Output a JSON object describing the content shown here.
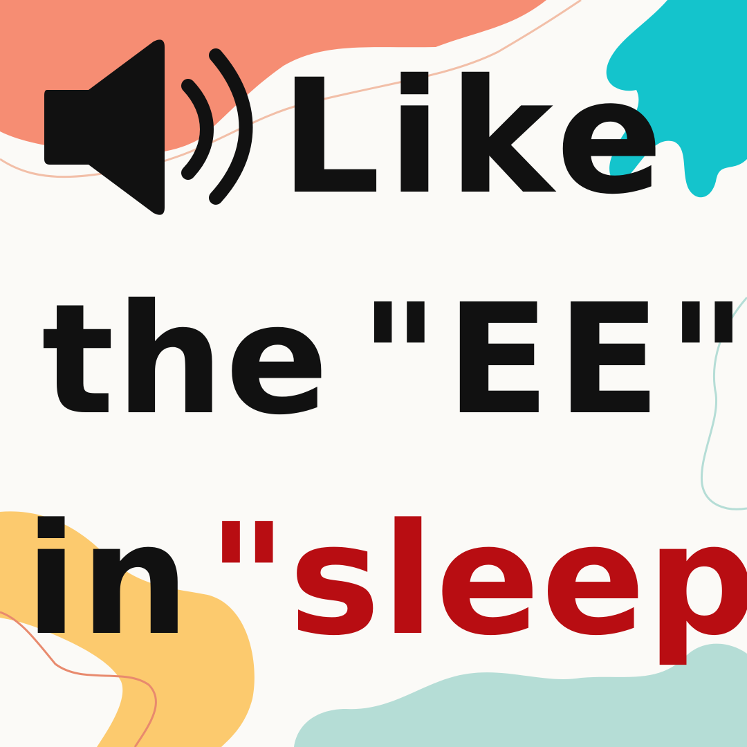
{
  "text": {
    "line1": "Like",
    "line2_word": "the",
    "line2_quote": "\"EE\"",
    "line3_word": "in",
    "line3_quote": "\"sleep\""
  },
  "colors": {
    "background": "#fbfaf7",
    "text": "#111111",
    "highlight": "#b80d12",
    "blob_coral": "#f68d73",
    "blob_teal": "#14c4cc",
    "blob_yellow": "#fcca6e",
    "blob_mint": "#b5ddd6"
  },
  "icons": {
    "speaker": "speaker-volume-icon"
  }
}
